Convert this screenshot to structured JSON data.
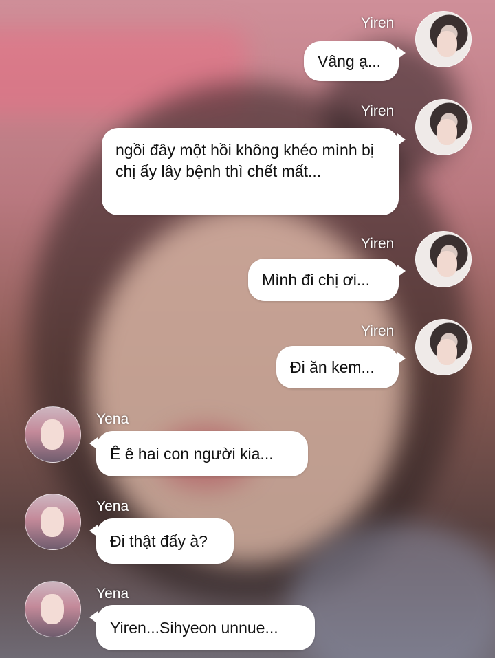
{
  "messages": [
    {
      "sender": "Yiren",
      "text": "Vâng ạ..."
    },
    {
      "sender": "Yiren",
      "text": "ngồi đây một hồi không khéo mình bị chị ấy lây bệnh thì chết mất..."
    },
    {
      "sender": "Yiren",
      "text": "Mình đi chị ơi..."
    },
    {
      "sender": "Yiren",
      "text": "Đi ăn kem..."
    },
    {
      "sender": "Yena",
      "text": "Ê ê hai con người kia..."
    },
    {
      "sender": "Yena",
      "text": "Đi thật đấy à?"
    },
    {
      "sender": "Yena",
      "text": "Yiren...Sihyeon unnue..."
    }
  ],
  "colors": {
    "bubble": "#ffffff",
    "text": "#111111",
    "sender_name": "#ffffff"
  }
}
